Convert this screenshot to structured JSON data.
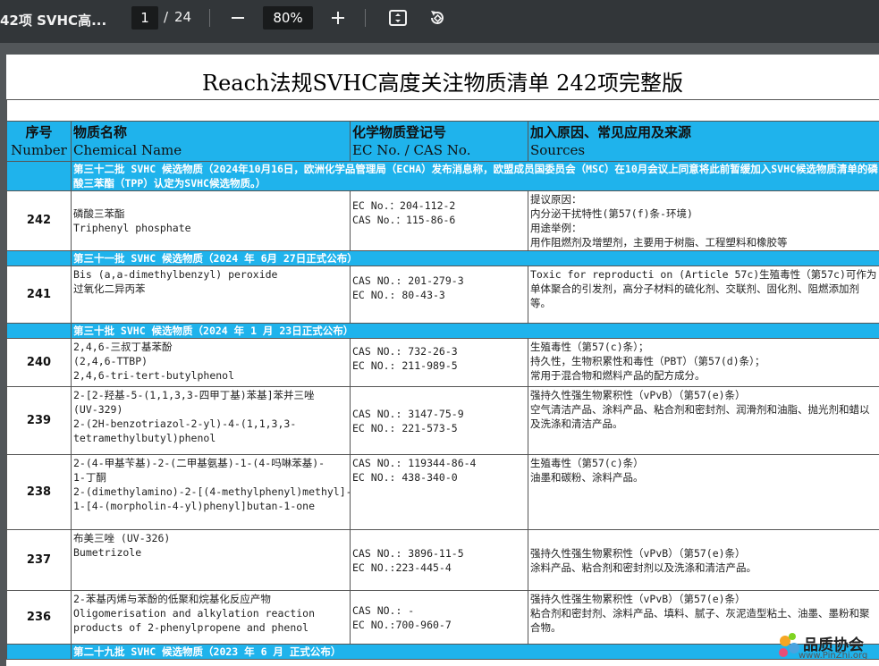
{
  "toolbar": {
    "doc_title": "42项 SVHC高...",
    "page_current": "1",
    "page_sep": "/",
    "page_total": "24",
    "zoom": "80%",
    "icons": [
      "zoom-out-icon",
      "zoom-in-icon",
      "fit-page-icon",
      "rotate-icon"
    ]
  },
  "page": {
    "title": "Reach法规SVHC高度关注物质清单 242项完整版",
    "header": {
      "num_zh": "序号",
      "num_en": "Number",
      "name_zh": "物质名称",
      "name_en": "Chemical Name",
      "ec_zh": "化学物质登记号",
      "ec_en": "EC No. / CAS No.",
      "src_zh": "加入原因、常见应用及来源",
      "src_en": "Sources"
    },
    "batch32": "第三十二批 SVHC 候选物质（2024年10月16日，欧洲化学品管理局（ECHA）发布消息称，欧盟成员国委员会（MSC）在10月会议上同意将此前暂缓加入SVHC候选物质清单的磷酸三苯酯（TPP）认定为SVHC候选物质。）",
    "batch31": "第三十一批 SVHC 候选物质（2024 年 6月 27日正式公布）",
    "batch30": "第三十批 SVHC 候选物质（2024 年 1 月 23日正式公布）",
    "batch29": "第二十九批 SVHC 候选物质（2023 年 6 月 正式公布）",
    "rows": {
      "r242": {
        "num": "242",
        "name": [
          "磷酸三苯酯",
          "Triphenyl phosphate"
        ],
        "ec": [
          "EC No.：204-112-2",
          "CAS No.：115-86-6"
        ],
        "src": [
          "提议原因：",
          "内分泌干扰特性(第57(f)条-环境)",
          "用途举例：",
          "用作阻燃剂及增塑剂，主要用于树脂、工程塑料和橡胶等"
        ]
      },
      "r241": {
        "num": "241",
        "name": [
          "Bis (a,a-dimethylbenzyl) peroxide",
          "过氧化二异丙苯"
        ],
        "ec": [
          "CAS NO.: 201-279-3",
          "EC NO.:  80-43-3"
        ],
        "src": "Toxic for reproducti on (Article 57c)生殖毒性（第57c)可作为单体聚合的引发剂，高分子材料的硫化剂、交联剂、固化剂、阻燃添加剂等。"
      },
      "r240": {
        "num": "240",
        "name": [
          "2,4,6-三叔丁基苯酚",
          "(2,4,6-TTBP)",
          "2,4,6-tri-tert-butylphenol"
        ],
        "ec": [
          "CAS NO.: 732-26-3",
          "EC NO.: 211-989-5"
        ],
        "src": [
          "生殖毒性（第57(c)条）；",
          "持久性，生物积累性和毒性（PBT）（第57(d)条）；",
          "常用于混合物和燃料产品的配方成分。"
        ]
      },
      "r239": {
        "num": "239",
        "name": [
          "2-[2-羟基-5-(1,1,3,3-四甲丁基)苯基]苯并三唑",
          "(UV-329)",
          "2-(2H-benzotriazol-2-yl)-4-(1,1,3,3-",
          "tetramethylbutyl)phenol"
        ],
        "ec": [
          "CAS NO.: 3147-75-9",
          "EC NO.: 221-573-5"
        ],
        "src": [
          "强持久性强生物累积性（vPvB）（第57(e)条）",
          "空气清洁产品、涂料产品、粘合剂和密封剂、润滑剂和油脂、抛光剂和蜡以及洗涤和清洁产品。"
        ]
      },
      "r238": {
        "num": "238",
        "name": [
          "2-(4-甲基苄基)-2-(二甲基氨基)-1-(4-吗啉苯基)-",
          "1-丁酮",
          "2-(dimethylamino)-2-[(4-methylphenyl)methyl]-",
          "1-[4-(morpholin-4-yl)phenyl]butan-1-one"
        ],
        "ec": [
          "CAS NO.: 119344-86-4",
          "EC NO.: 438-340-0"
        ],
        "src": [
          "生殖毒性（第57(c)条）",
          "油墨和碳粉、涂料产品。"
        ]
      },
      "r237": {
        "num": "237",
        "name": [
          "布美三唑 (UV-326)",
          "Bumetrizole"
        ],
        "ec": [
          "CAS NO.: 3896-11-5",
          "EC NO.:223-445-4"
        ],
        "src": [
          "强持久性强生物累积性（vPvB）（第57(e)条）",
          "涂料产品、粘合剂和密封剂以及洗涤和清洁产品。"
        ]
      },
      "r236": {
        "num": "236",
        "name": [
          "2-苯基丙烯与苯酚的低聚和烷基化反应产物",
          "Oligomerisation and alkylation reaction",
          "products of 2-phenylpropene and phenol"
        ],
        "ec": [
          "CAS NO.: -",
          "EC NO.:700-960-7"
        ],
        "src": [
          "强持久性强生物累积性（vPvB）（第57(e)条）",
          "粘合剂和密封剂、涂料产品、填料、腻子、灰泥造型粘土、油墨、墨粉和聚合物。"
        ]
      }
    },
    "watermark": {
      "text": "品质协会",
      "url": "www.PinZhi.org"
    }
  }
}
